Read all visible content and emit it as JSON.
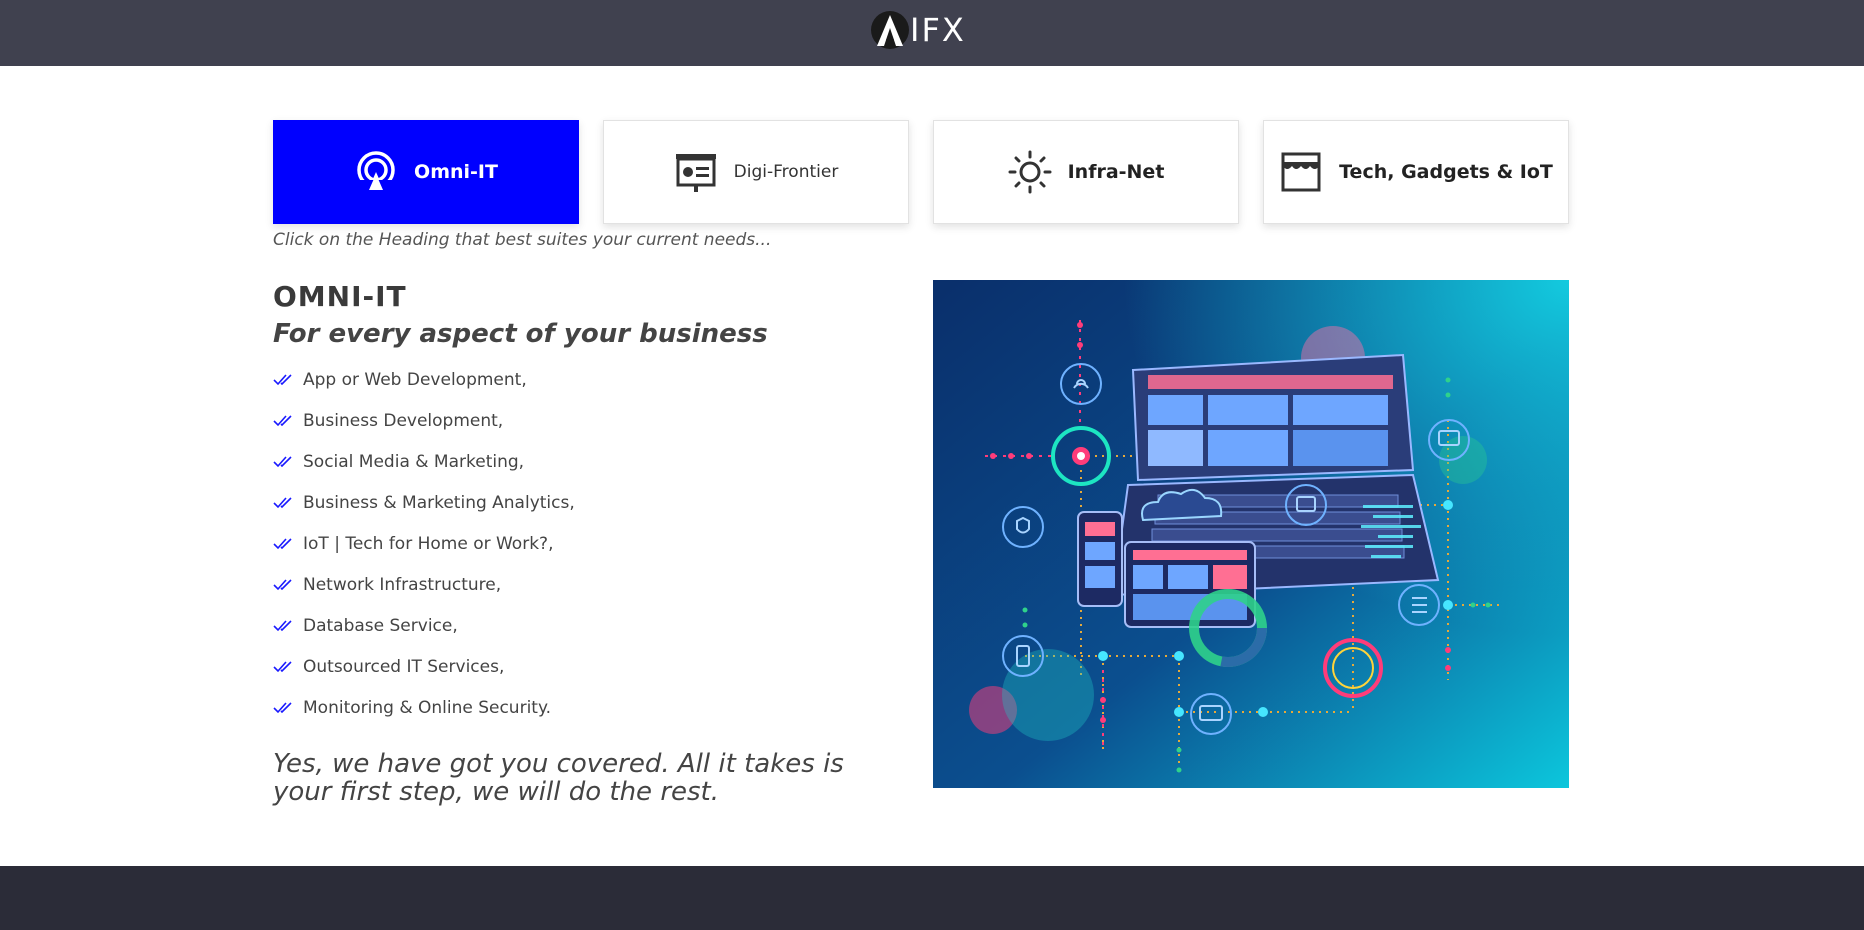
{
  "header": {
    "logo_text": "IFX",
    "logo_icon": "aifx-logo-icon"
  },
  "tabs": [
    {
      "label": "Omni-IT",
      "icon": "wifi-pin-icon",
      "active": true
    },
    {
      "label": "Digi-Frontier",
      "icon": "presentation-board-icon",
      "active": false
    },
    {
      "label": "Infra-Net",
      "icon": "sun-icon",
      "active": false
    },
    {
      "label": "Tech, Gadgets & IoT",
      "icon": "storefront-icon",
      "active": false
    }
  ],
  "hint": "Click on the Heading that best suites your current needs...",
  "main": {
    "heading": "OMNI-IT",
    "subheading": "For every aspect of your business",
    "features": [
      "App or Web Development,",
      "Business Development,",
      "Social Media & Marketing,",
      "Business & Marketing Analytics,",
      "IoT | Tech for Home or Work?,",
      "Network Infrastructure,",
      "Database Service,",
      "Outsourced IT Services,",
      "Monitoring & Online Security."
    ],
    "closing": "Yes, we have got you covered. All it takes is your first step, we will do the rest."
  },
  "hero_image": "technology-network-illustration",
  "colors": {
    "accent": "#0000ff",
    "header_bg": "#40414f",
    "footer_bg": "#2b2c38",
    "check": "#1a1aff"
  }
}
